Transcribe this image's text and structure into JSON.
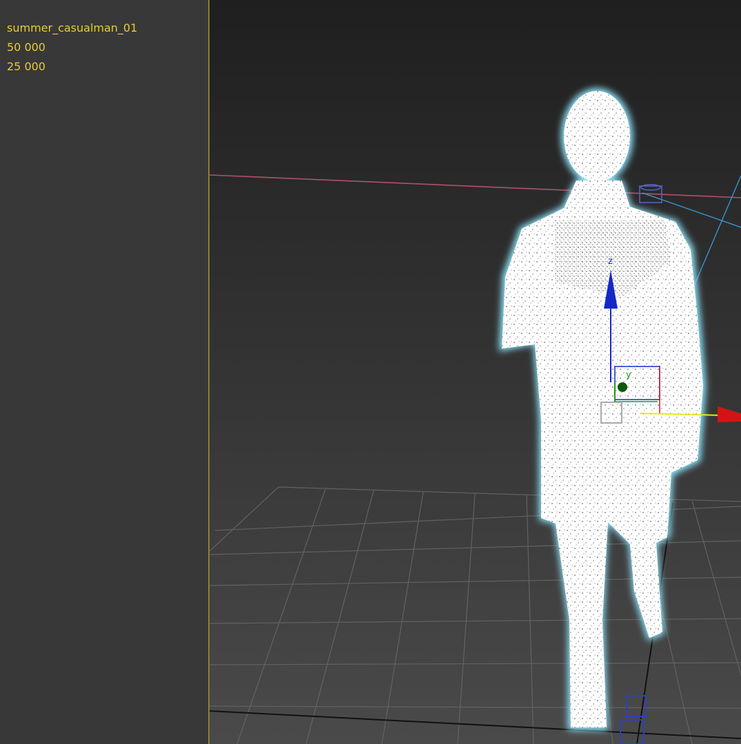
{
  "stats": {
    "object_name": "summer_casualman_01",
    "polygons": "50 000",
    "vertices": "25 000"
  },
  "gizmo": {
    "axis_z_label": "z",
    "axis_y_label": "y"
  },
  "colors": {
    "stats_text": "#e8cc32",
    "viewport_border": "#8f7d36",
    "axis_x": "#d11515",
    "axis_y": "#1c9a1c",
    "axis_z": "#1428c8",
    "selection_glow": "#8fe8ff",
    "grid": "#6a6a6a",
    "horizon_line": "#b0506a",
    "light_line": "#3a9ad8"
  },
  "icons": [
    "move-gizmo-icon",
    "pivot-marker-icon",
    "bone-helper-icon"
  ]
}
